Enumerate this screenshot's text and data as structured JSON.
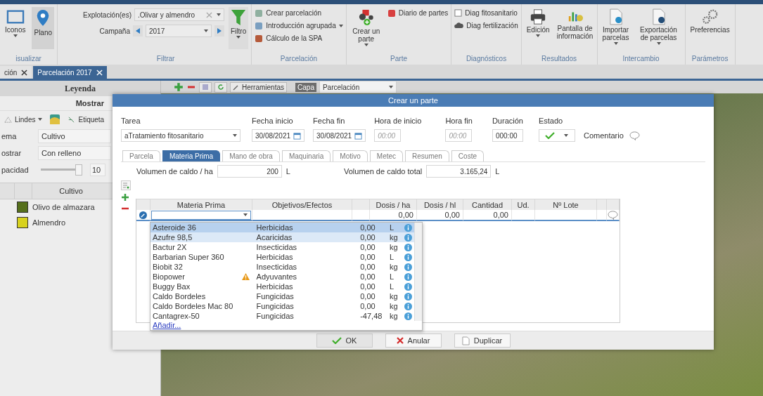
{
  "ribbon": {
    "visualizar": {
      "label": "isualizar",
      "iconos": {
        "label": "Iconos",
        "selected": false
      },
      "plano": {
        "label": "Plano",
        "selected": true
      }
    },
    "filtrar": {
      "label": "Filtrar",
      "explotacion_label": "Explotación(es)",
      "explotacion_value": ".Olivar y almendro",
      "campana_label": "Campaña",
      "campana_value": "2017",
      "filtro": "Filtro"
    },
    "parcelacion": {
      "label": "Parcelación",
      "items": [
        "Crear parcelación",
        "Introducción agrupada",
        "Cálculo de la SPA"
      ]
    },
    "parte": {
      "label": "Parte",
      "crear": "Crear un parte",
      "diario": "Diario de partes"
    },
    "diagnosticos": {
      "label": "Diagnósticos",
      "items": [
        "Diag fitosanitario",
        "Diag fertilización"
      ]
    },
    "resultados": {
      "label": "Resultados",
      "items": [
        "Edición",
        "Pantalla de información"
      ]
    },
    "intercambio": {
      "label": "Intercambio",
      "items": [
        "Importar parcelas",
        "Exportación de parcelas"
      ]
    },
    "parametros": {
      "label": "Parámetros",
      "items": [
        "Preferencias"
      ]
    }
  },
  "doc_tabs": [
    {
      "label": "ción",
      "selected": false
    },
    {
      "label": "Parcelación 2017",
      "selected": true
    }
  ],
  "legend": {
    "title": "Leyenda",
    "mostrar": "Mostrar",
    "lindes": "Lindes",
    "etiqueta": "Etiqueta",
    "fields": [
      {
        "label": "ema",
        "value": "Cultivo"
      },
      {
        "label": "ostrar",
        "value": "Con relleno"
      }
    ],
    "opacidad": {
      "label": "pacidad",
      "level": 0.92,
      "reading": "10"
    },
    "column": "Cultivo",
    "rows": [
      {
        "name": "Olivo de almazara",
        "color": "#56701c"
      },
      {
        "name": "Almendro",
        "color": "#d8d21e"
      }
    ]
  },
  "map_toolbar": {
    "herramientas": "Herramientas",
    "capa_label": "Capa",
    "capa_value": "Parcelación"
  },
  "dialog": {
    "title": "Crear un parte",
    "tarea": {
      "label": "Tarea",
      "value": "aTratamiento fitosanitario"
    },
    "fecha_inicio": {
      "label": "Fecha inicio",
      "value": "30/08/2021"
    },
    "fecha_fin": {
      "label": "Fecha fin",
      "value": "30/08/2021"
    },
    "hora_inicio": {
      "label": "Hora de inicio",
      "placeholder": "00:00"
    },
    "hora_fin": {
      "label": "Hora fin",
      "placeholder": "00:00"
    },
    "duracion": {
      "label": "Duración",
      "value": "000:00"
    },
    "estado": {
      "label": "Estado"
    },
    "comentario": "Comentario",
    "tabs": [
      {
        "label": "Parcela",
        "selected": false
      },
      {
        "label": "Materia Prima",
        "selected": true
      },
      {
        "label": "Mano de obra",
        "selected": false
      },
      {
        "label": "Maquinaria",
        "selected": false
      },
      {
        "label": "Motivo",
        "selected": false
      },
      {
        "label": "Metec",
        "selected": false
      },
      {
        "label": "Resumen",
        "selected": false
      },
      {
        "label": "Coste",
        "selected": false
      }
    ],
    "volumen_ha": {
      "label": "Volumen de caldo / ha",
      "value": "200",
      "unit": "L"
    },
    "volumen_total": {
      "label": "Volumen de caldo total",
      "value": "3.165,24",
      "unit": "L"
    },
    "table": {
      "columns": [
        "Materia Prima",
        "Objetivos/Efectos",
        "Dosis / ha",
        "Dosis / hl",
        "Cantidad",
        "Ud.",
        "Nº Lote"
      ],
      "row": {
        "dosis_ha": "0,00",
        "dosis_hl": "0,00",
        "cantidad": "0,00"
      }
    },
    "dropdown": {
      "items": [
        {
          "name": "Asteroide 36",
          "warning": false,
          "objetivo": "Herbicidas",
          "dosis": "0,00",
          "ud": "L",
          "selected": true,
          "hovered": false
        },
        {
          "name": "Azufre 98,5",
          "warning": false,
          "objetivo": "Acaricidas",
          "dosis": "0,00",
          "ud": "kg",
          "selected": false,
          "hovered": true
        },
        {
          "name": "Bactur 2X",
          "warning": false,
          "objetivo": "Insecticidas",
          "dosis": "0,00",
          "ud": "kg",
          "selected": false,
          "hovered": false
        },
        {
          "name": "Barbarian Super 360",
          "warning": false,
          "objetivo": "Herbicidas",
          "dosis": "0,00",
          "ud": "L",
          "selected": false,
          "hovered": false
        },
        {
          "name": "Biobit 32",
          "warning": false,
          "objetivo": "Insecticidas",
          "dosis": "0,00",
          "ud": "kg",
          "selected": false,
          "hovered": false
        },
        {
          "name": "Biopower",
          "warning": true,
          "objetivo": "Adyuvantes",
          "dosis": "0,00",
          "ud": "L",
          "selected": false,
          "hovered": false
        },
        {
          "name": "Buggy Bax",
          "warning": false,
          "objetivo": "Herbicidas",
          "dosis": "0,00",
          "ud": "L",
          "selected": false,
          "hovered": false
        },
        {
          "name": "Caldo Bordeles",
          "warning": false,
          "objetivo": "Fungicidas",
          "dosis": "0,00",
          "ud": "kg",
          "selected": false,
          "hovered": false
        },
        {
          "name": "Caldo Bordeles Mac 80",
          "warning": false,
          "objetivo": "Fungicidas",
          "dosis": "0,00",
          "ud": "kg",
          "selected": false,
          "hovered": false
        },
        {
          "name": "Cantagrex-50",
          "warning": false,
          "objetivo": "Fungicidas",
          "dosis": "-47,48",
          "ud": "kg",
          "selected": false,
          "hovered": false
        }
      ],
      "add": "Añadir..."
    },
    "buttons": [
      {
        "kind": "ok",
        "label": "OK"
      },
      {
        "kind": "cancel",
        "label": "Anular"
      },
      {
        "kind": "duplicate",
        "label": "Duplicar"
      }
    ]
  }
}
